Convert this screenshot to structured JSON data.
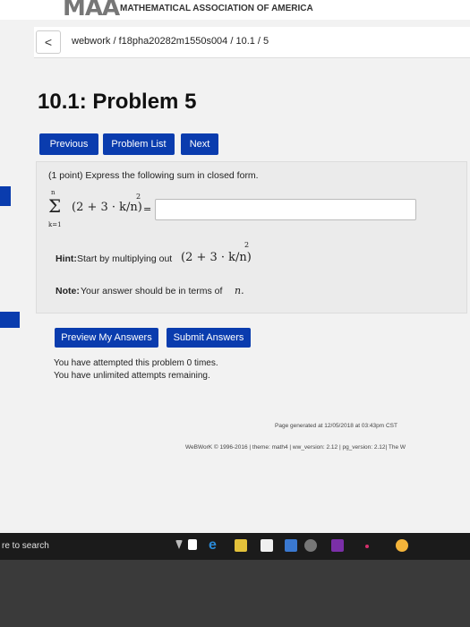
{
  "header": {
    "logo": "MAA",
    "org_name": "MATHEMATICAL ASSOCIATION OF AMERICA"
  },
  "breadcrumb": {
    "back_symbol": "<",
    "path": "webwork / f18pha20282m1550s004 / 10.1 / 5"
  },
  "page": {
    "title": "10.1: Problem 5"
  },
  "nav": {
    "previous": "Previous",
    "problem_list": "Problem List",
    "next": "Next"
  },
  "problem": {
    "intro": "(1 point) Express the following sum in closed form.",
    "sum_symbol": "Σ",
    "sum_upper": "n",
    "sum_lower": "k=1",
    "expression": "(2 + 3 · k/n)",
    "exponent": "2",
    "equals": "=",
    "answer_value": "",
    "hint_label": "Hint:",
    "hint_text": "Start by multiplying out",
    "hint_expression": "(2 + 3 · k/n)",
    "hint_exponent": "2",
    "note_label": "Note:",
    "note_text": "Your answer should be in terms of",
    "note_var": "n."
  },
  "actions": {
    "preview": "Preview My Answers",
    "submit": "Submit Answers"
  },
  "attempts": {
    "line1": "You have attempted this problem 0 times.",
    "line2": "You have unlimited attempts remaining."
  },
  "footer": {
    "generated": "Page generated at 12/05/2018 at 03:43pm CST",
    "version": "WeBWorK © 1996-2016 | theme: math4 | ww_version: 2.12 | pg_version: 2.12| The W"
  },
  "taskbar": {
    "search_text": "re to search"
  },
  "colors": {
    "accent": "#0a3cae",
    "taskbar": "#1b1b1b"
  }
}
